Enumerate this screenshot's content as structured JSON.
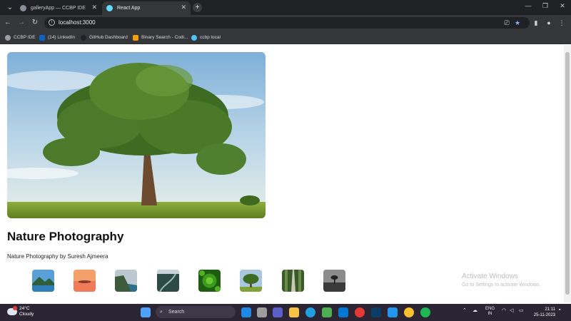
{
  "browser": {
    "tabs": [
      {
        "label": "galleryApp — CCBP IDE",
        "active": false
      },
      {
        "label": "React App",
        "active": true
      }
    ],
    "address": "localhost:3000",
    "bookmarks": [
      {
        "label": "CCBP IDE",
        "color": "#9aa0a6"
      },
      {
        "label": "(14) LinkedIn",
        "color": "#0a66c2"
      },
      {
        "label": "GitHub Dashboard",
        "color": "#1f2328"
      },
      {
        "label": "Binary Search - Codi...",
        "color": "#f59e0b"
      },
      {
        "label": "ccbp local",
        "color": "#4fc3f7"
      }
    ]
  },
  "page": {
    "title": "Nature Photography",
    "subtitle": "Nature Photography by Suresh Ajmeera",
    "thumbnails": [
      {
        "icon": "lake-mountain-thumbnail"
      },
      {
        "icon": "sunset-thumbnail"
      },
      {
        "icon": "cliff-thumbnail"
      },
      {
        "icon": "mountain-road-thumbnail"
      },
      {
        "icon": "green-plant-thumbnail"
      },
      {
        "icon": "tree-thumbnail"
      },
      {
        "icon": "forest-road-thumbnail"
      },
      {
        "icon": "bw-tree-thumbnail"
      }
    ]
  },
  "watermark": {
    "line1": "Activate Windows",
    "line2": "Go to Settings to activate Windows."
  },
  "taskbar": {
    "weather_temp": "24°C",
    "weather_desc": "Cloudy",
    "search_label": "Search",
    "lang1": "ENG",
    "lang2": "IN",
    "time": "21:11",
    "date": "25-11-2023"
  },
  "colors": {
    "tab_bar": "#202124",
    "toolbar": "#35363a",
    "taskbar": "#2b2433"
  }
}
